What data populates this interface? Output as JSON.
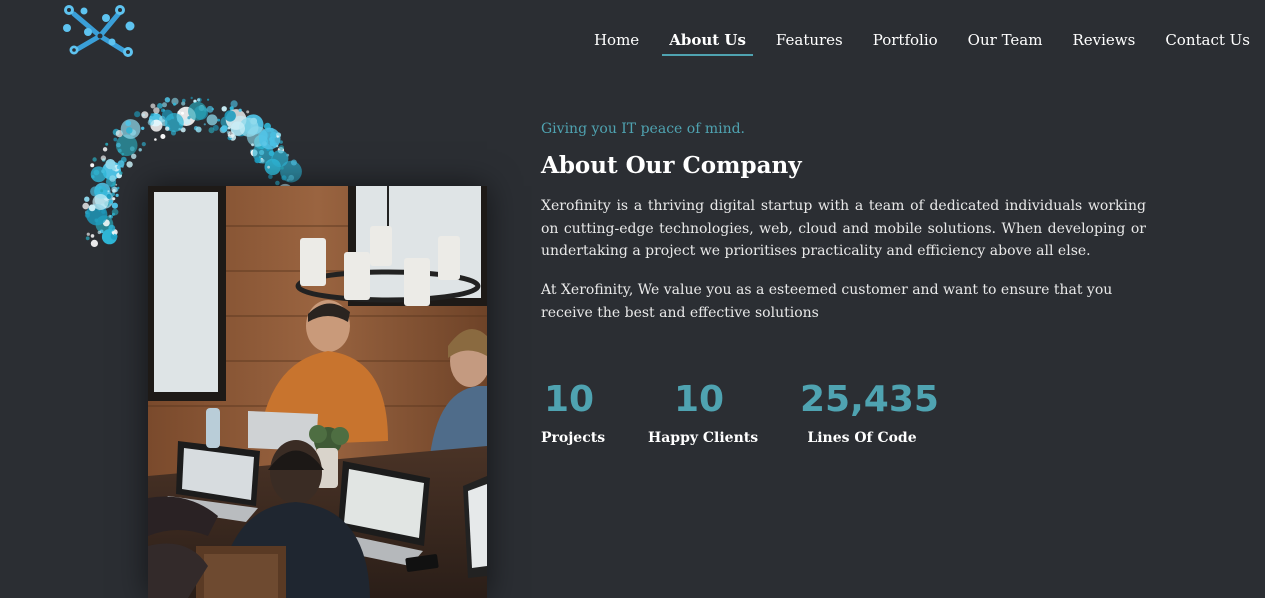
{
  "brand": {
    "logo_icon": "molecule-x-logo-icon",
    "accent_color": "#4fa3b1",
    "background_color": "#2b2e33"
  },
  "nav": {
    "items": [
      {
        "label": "Home",
        "active": false
      },
      {
        "label": "About Us",
        "active": true
      },
      {
        "label": "Features",
        "active": false
      },
      {
        "label": "Portfolio",
        "active": false
      },
      {
        "label": "Our Team",
        "active": false
      },
      {
        "label": "Reviews",
        "active": false
      },
      {
        "label": "Contact Us",
        "active": false
      }
    ]
  },
  "about": {
    "tagline": "Giving you IT peace of mind.",
    "heading": "About Our Company",
    "paragraph1": "Xerofinity is a thriving digital startup with a team of dedicated individuals working on cutting-edge technologies, web, cloud and mobile solutions. When developing or undertaking a project we prioritises practicality and efficiency above all else.",
    "paragraph2": "At Xerofinity, We value you as a esteemed customer and want to ensure that you receive the best and effective solutions",
    "image_icon": "team-working-photo"
  },
  "stats": [
    {
      "value": "10",
      "label": "Projects"
    },
    {
      "value": "10",
      "label": "Happy Clients"
    },
    {
      "value": "25,435",
      "label": "Lines Of Code"
    }
  ]
}
